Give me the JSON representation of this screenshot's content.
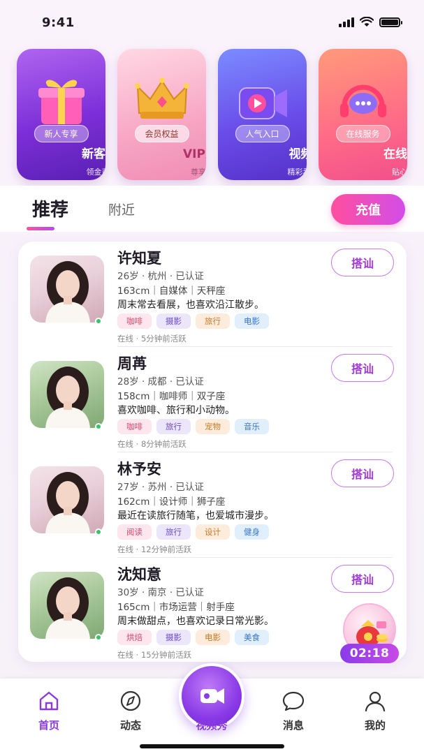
{
  "status_bar": {
    "time": "9:41"
  },
  "features": [
    {
      "badge": "新人专享",
      "title": "新客福利",
      "sub": "领金币礼包",
      "icon": "gift-icon"
    },
    {
      "badge": "会员权益",
      "title": "VIP入口",
      "sub": "尊享特权",
      "icon": "crown-icon"
    },
    {
      "badge": "人气入口",
      "title": "视频秀",
      "sub": "精彩看不停",
      "icon": "video-camera-icon"
    },
    {
      "badge": "在线服务",
      "title": "在线客服",
      "sub": "贴心解答",
      "icon": "headset-chat-icon"
    }
  ],
  "tabs": {
    "recommend": "推荐",
    "nearby": "附近",
    "recharge": "充值"
  },
  "users": [
    {
      "name": "许知夏",
      "meta1": "26岁 · 杭州 · 已认证",
      "meta2": "163cm｜自媒体｜天秤座",
      "bio": "周末常去看展，也喜欢沿江散步。",
      "tags": [
        {
          "text": "咖啡",
          "style": "t-pink"
        },
        {
          "text": "摄影",
          "style": "t-purple"
        },
        {
          "text": "旅行",
          "style": "t-orange"
        },
        {
          "text": "电影",
          "style": "t-blue"
        }
      ],
      "status": "在线 · 5分钟前活跃",
      "button": "搭讪"
    },
    {
      "name": "周苒",
      "meta1": "28岁 · 成都 · 已认证",
      "meta2": "158cm｜咖啡师｜双子座",
      "bio": "喜欢咖啡、旅行和小动物。",
      "tags": [
        {
          "text": "咖啡",
          "style": "t-pink"
        },
        {
          "text": "旅行",
          "style": "t-purple"
        },
        {
          "text": "宠物",
          "style": "t-orange"
        },
        {
          "text": "音乐",
          "style": "t-blue"
        }
      ],
      "status": "在线 · 8分钟前活跃",
      "button": "搭讪"
    },
    {
      "name": "林予安",
      "meta1": "27岁 · 苏州 · 已认证",
      "meta2": "162cm｜设计师｜狮子座",
      "bio": "最近在读旅行随笔，也爱城市漫步。",
      "tags": [
        {
          "text": "阅读",
          "style": "t-pink"
        },
        {
          "text": "旅行",
          "style": "t-purple"
        },
        {
          "text": "设计",
          "style": "t-orange"
        },
        {
          "text": "健身",
          "style": "t-blue"
        }
      ],
      "status": "在线 · 12分钟前活跃",
      "button": "搭讪"
    },
    {
      "name": "沈知意",
      "meta1": "30岁 · 南京 · 已认证",
      "meta2": "165cm｜市场运营｜射手座",
      "bio": "周末做甜点，也喜欢记录日常光影。",
      "tags": [
        {
          "text": "烘焙",
          "style": "t-pink"
        },
        {
          "text": "摄影",
          "style": "t-purple"
        },
        {
          "text": "电影",
          "style": "t-orange"
        },
        {
          "text": "美食",
          "style": "t-blue"
        }
      ],
      "status": "在线 · 15分钟前活跃",
      "button": "搭讪"
    }
  ],
  "floating_timer": "02:18",
  "nav": {
    "home": "首页",
    "feed": "动态",
    "video": "视频秀",
    "messages": "消息",
    "me": "我的"
  }
}
